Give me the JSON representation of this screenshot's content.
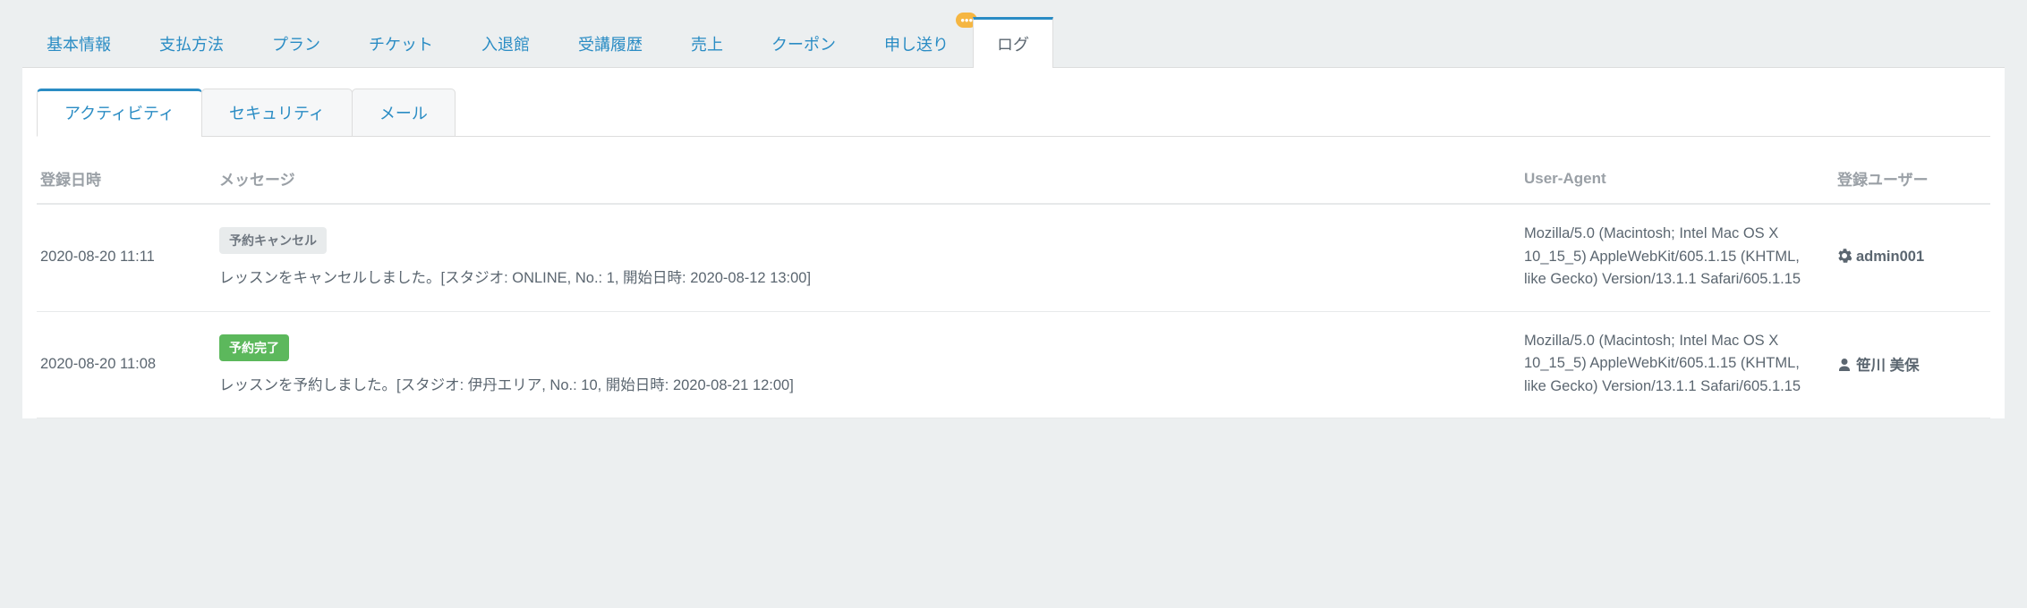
{
  "main_tabs": {
    "items": [
      {
        "label": "基本情報"
      },
      {
        "label": "支払方法"
      },
      {
        "label": "プラン"
      },
      {
        "label": "チケット"
      },
      {
        "label": "入退館"
      },
      {
        "label": "受講履歴"
      },
      {
        "label": "売上"
      },
      {
        "label": "クーポン"
      },
      {
        "label": "申し送り",
        "badge": "•••"
      },
      {
        "label": "ログ",
        "active": true
      }
    ]
  },
  "sub_tabs": {
    "items": [
      {
        "label": "アクティビティ",
        "active": true
      },
      {
        "label": "セキュリティ"
      },
      {
        "label": "メール"
      }
    ]
  },
  "table": {
    "headers": {
      "date": "登録日時",
      "message": "メッセージ",
      "user_agent": "User-Agent",
      "user": "登録ユーザー"
    },
    "rows": [
      {
        "date": "2020-08-20 11:11",
        "tag_label": "予約キャンセル",
        "tag_style": "gray",
        "message": "レッスンをキャンセルしました。[スタジオ: ONLINE, No.: 1, 開始日時: 2020-08-12 13:00]",
        "user_agent": "Mozilla/5.0 (Macintosh; Intel Mac OS X 10_15_5) AppleWebKit/605.1.15 (KHTML, like Gecko) Version/13.1.1 Safari/605.1.15",
        "user_icon": "gear",
        "user": "admin001"
      },
      {
        "date": "2020-08-20 11:08",
        "tag_label": "予約完了",
        "tag_style": "green",
        "message": "レッスンを予約しました。[スタジオ: 伊丹エリア, No.: 10, 開始日時: 2020-08-21 12:00]",
        "user_agent": "Mozilla/5.0 (Macintosh; Intel Mac OS X 10_15_5) AppleWebKit/605.1.15 (KHTML, like Gecko) Version/13.1.1 Safari/605.1.15",
        "user_icon": "user",
        "user": "笹川 美保"
      }
    ]
  }
}
